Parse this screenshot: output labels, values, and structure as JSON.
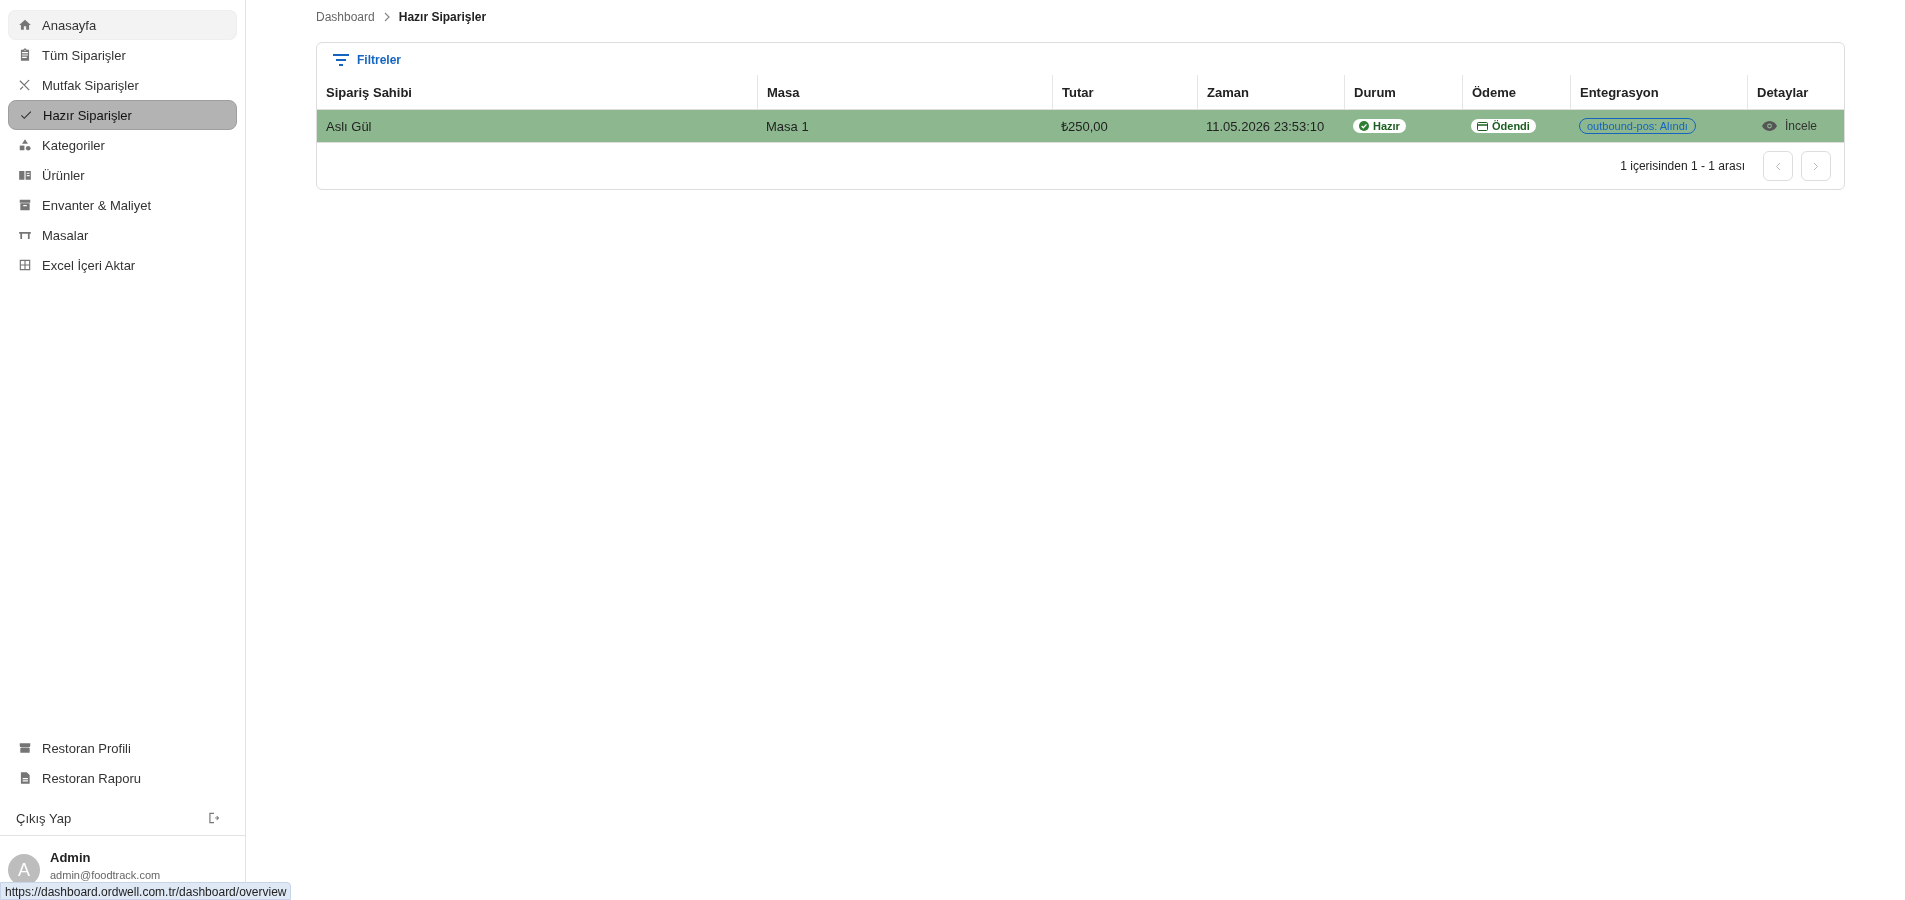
{
  "sidebar": {
    "items": [
      {
        "label": "Anasayfa",
        "selected": false,
        "hovered": true
      },
      {
        "label": "Tüm Siparişler",
        "selected": false,
        "hovered": false
      },
      {
        "label": "Mutfak Siparişler",
        "selected": false,
        "hovered": false
      },
      {
        "label": "Hazır Siparişler",
        "selected": true,
        "hovered": false
      },
      {
        "label": "Kategoriler",
        "selected": false,
        "hovered": false
      },
      {
        "label": "Ürünler",
        "selected": false,
        "hovered": false
      },
      {
        "label": "Envanter & Maliyet",
        "selected": false,
        "hovered": false
      },
      {
        "label": "Masalar",
        "selected": false,
        "hovered": false
      },
      {
        "label": "Excel İçeri Aktar",
        "selected": false,
        "hovered": false
      }
    ],
    "bottom_items": [
      {
        "label": "Restoran Profili"
      },
      {
        "label": "Restoran Raporu"
      }
    ],
    "logout": "Çıkış Yap",
    "user": {
      "avatar": "A",
      "name": "Admin",
      "email": "admin@foodtrack.com"
    }
  },
  "status_url": "https://dashboard.ordwell.com.tr/dashboard/overview",
  "breadcrumb": [
    "Dashboard",
    "Hazır Siparişler"
  ],
  "filters_button": "Filtreler",
  "table": {
    "columns": [
      "Sipariş Sahibi",
      "Masa",
      "Tutar",
      "Zaman",
      "Durum",
      "Ödeme",
      "Entegrasyon",
      "Detaylar"
    ],
    "rows": [
      {
        "highlighted": true,
        "owner": "Aslı Gül",
        "table": "Masa 1",
        "amount": "₺250,00",
        "time": "11.05.2026 23:53:10",
        "status": "Hazır",
        "payment": "Ödendi",
        "integration": "outbound-pos: Alındı",
        "details": "İncele"
      }
    ]
  },
  "pagination": {
    "summary": "1 içerisinden 1 - 1 arası",
    "prev_disabled": true,
    "next_disabled": true
  }
}
